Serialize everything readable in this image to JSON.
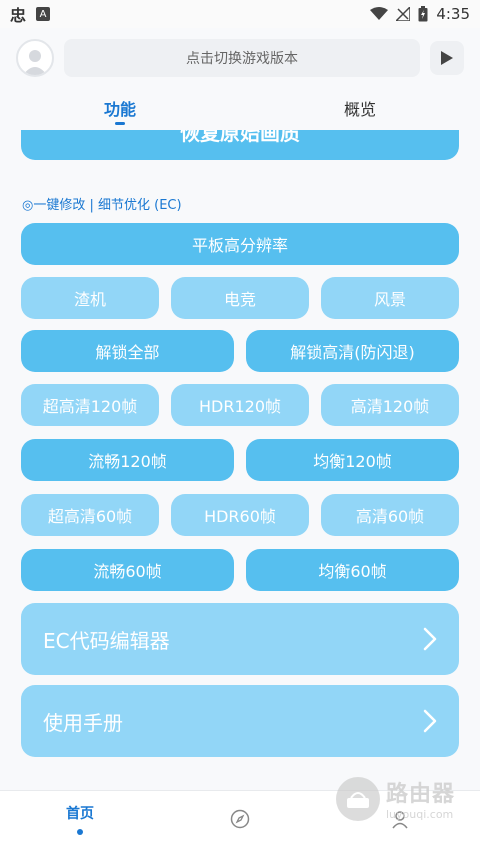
{
  "status_bar": {
    "time": "4:35",
    "icons": [
      "app-logo-icon",
      "a-badge-icon",
      "wifi-icon",
      "no-signal-icon",
      "battery-charging-icon"
    ]
  },
  "header": {
    "search_placeholder": "点击切换游戏版本",
    "play_icon": "play-icon",
    "avatar_icon": "avatar-icon"
  },
  "tabs": [
    {
      "label": "功能",
      "active": true
    },
    {
      "label": "概览",
      "active": false
    }
  ],
  "main": {
    "partial_button": "恢复原始画质",
    "section_label": "◎一键修改 | 细节优化 (EC)",
    "full_button": "平板高分辨率",
    "row1": [
      "渣机",
      "电竞",
      "风景"
    ],
    "row2": [
      "解锁全部",
      "解锁高清(防闪退)"
    ],
    "row3": [
      "超高清120帧",
      "HDR120帧",
      "高清120帧"
    ],
    "row4": [
      "流畅120帧",
      "均衡120帧"
    ],
    "row5": [
      "超高清60帧",
      "HDR60帧",
      "高清60帧"
    ],
    "row6": [
      "流畅60帧",
      "均衡60帧"
    ],
    "cards": [
      {
        "label": "EC代码编辑器",
        "icon": "chevron-right-icon"
      },
      {
        "label": "使用手册",
        "icon": "chevron-right-icon"
      }
    ]
  },
  "bottom_nav": {
    "home_label": "首页",
    "items": [
      "home",
      "compass-icon",
      "user-icon"
    ]
  },
  "watermark": {
    "big": "路由器",
    "small": "luyouqi.com"
  },
  "colors": {
    "accent": "#1a78d2",
    "button_dark": "#56bfef",
    "button_light": "#92d6f7"
  }
}
